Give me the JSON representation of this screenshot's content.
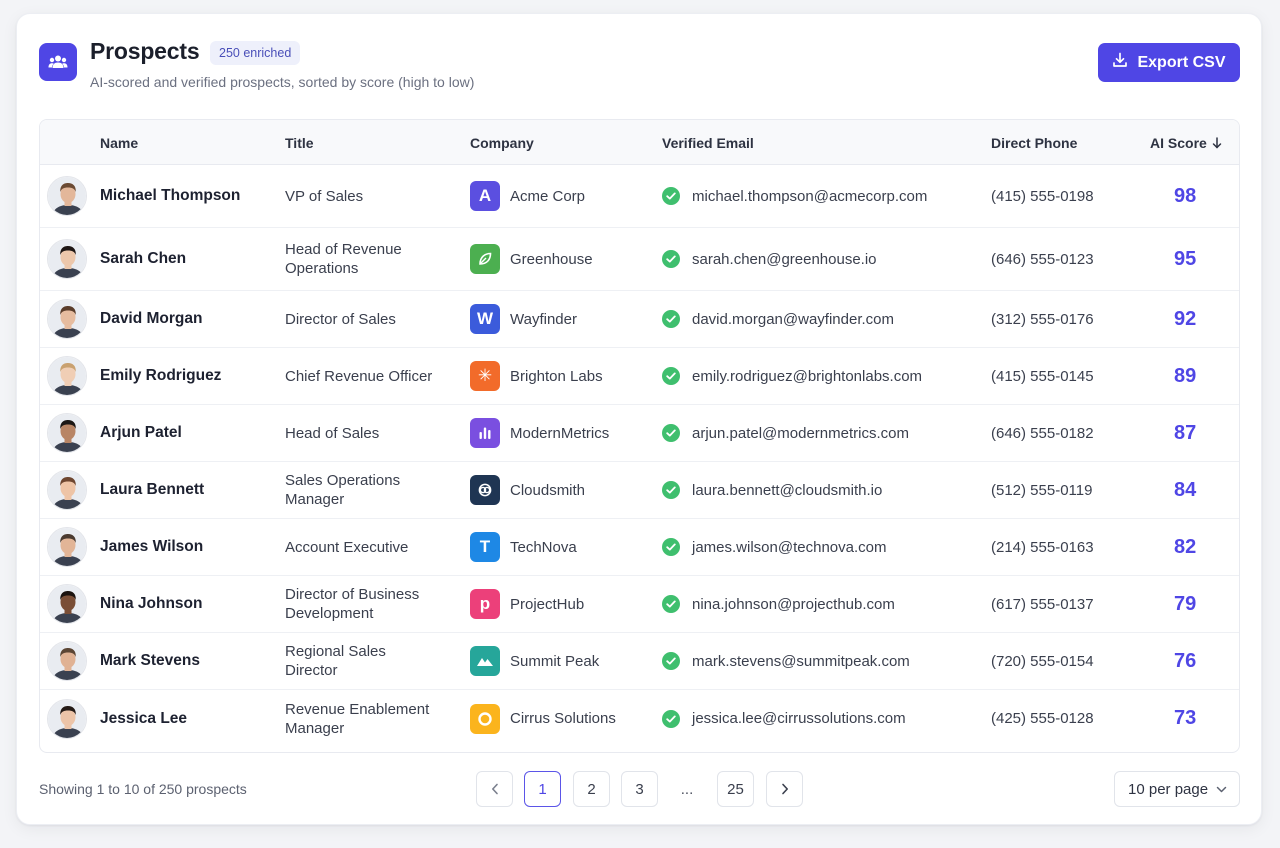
{
  "header": {
    "title": "Prospects",
    "badge": "250 enriched",
    "subtitle": "AI-scored and verified prospects, sorted by score (high to low)",
    "export_label": "Export CSV",
    "accent": "#4f46e5"
  },
  "columns": {
    "name": "Name",
    "title": "Title",
    "company": "Company",
    "email": "Verified Email",
    "phone": "Direct Phone",
    "score": "AI Score"
  },
  "rows": [
    {
      "name": "Michael Thompson",
      "title": "VP of Sales",
      "company": "Acme Corp",
      "logo": "A",
      "logo_color": "#5b4fe0",
      "email": "michael.thompson@acmecorp.com",
      "phone": "(415) 555-0198",
      "score": "98",
      "skin": "#e3b79a",
      "hair": "#6b4a33"
    },
    {
      "name": "Sarah Chen",
      "title": "Head of Revenue Operations",
      "company": "Greenhouse",
      "logo": "leaf",
      "logo_color": "#4caf50",
      "email": "sarah.chen@greenhouse.io",
      "phone": "(646) 555-0123",
      "score": "95",
      "skin": "#ecc7ab",
      "hair": "#1e1614"
    },
    {
      "name": "David Morgan",
      "title": "Director of Sales",
      "company": "Wayfinder",
      "logo": "W",
      "logo_color": "#3b5bdb",
      "email": "david.morgan@wayfinder.com",
      "phone": "(312) 555-0176",
      "score": "92",
      "skin": "#e6bc9f",
      "hair": "#5a3d2b"
    },
    {
      "name": "Emily Rodriguez",
      "title": "Chief Revenue Officer",
      "company": "Brighton Labs",
      "logo": "✳",
      "logo_color": "#f26b2a",
      "email": "emily.rodriguez@brightonlabs.com",
      "phone": "(415) 555-0145",
      "score": "89",
      "skin": "#f0ceb5",
      "hair": "#c9a170"
    },
    {
      "name": "Arjun Patel",
      "title": "Head of Sales",
      "company": "ModernMetrics",
      "logo": "bars",
      "logo_color": "#7a4fe0",
      "email": "arjun.patel@modernmetrics.com",
      "phone": "(646) 555-0182",
      "score": "87",
      "skin": "#b88565",
      "hair": "#1b1715"
    },
    {
      "name": "Laura Bennett",
      "title": "Sales Operations Manager",
      "company": "Cloudsmith",
      "logo": "cloud",
      "logo_color": "#1f3553",
      "email": "laura.bennett@cloudsmith.io",
      "phone": "(512) 555-0119",
      "score": "84",
      "skin": "#eec4a6",
      "hair": "#6e4630"
    },
    {
      "name": "James Wilson",
      "title": "Account Executive",
      "company": "TechNova",
      "logo": "T",
      "logo_color": "#1e88e5",
      "email": "james.wilson@technova.com",
      "phone": "(214) 555-0163",
      "score": "82",
      "skin": "#e2b597",
      "hair": "#4a3a30"
    },
    {
      "name": "Nina Johnson",
      "title": "Director of Business Development",
      "company": "ProjectHub",
      "logo": "p",
      "logo_color": "#ec407a",
      "email": "nina.johnson@projecthub.com",
      "phone": "(617) 555-0137",
      "score": "79",
      "skin": "#7a4e36",
      "hair": "#1a120e"
    },
    {
      "name": "Mark Stevens",
      "title": "Regional Sales Director",
      "company": "Summit Peak",
      "logo": "peak",
      "logo_color": "#26a69a",
      "email": "mark.stevens@summitpeak.com",
      "phone": "(720) 555-0154",
      "score": "76",
      "skin": "#e0b294",
      "hair": "#5b4534"
    },
    {
      "name": "Jessica Lee",
      "title": "Revenue Enablement Manager",
      "company": "Cirrus Solutions",
      "logo": "ring",
      "logo_color": "#fbb41d",
      "email": "jessica.lee@cirrussolutions.com",
      "phone": "(425) 555-0128",
      "score": "73",
      "skin": "#ecc4a8",
      "hair": "#241a16"
    }
  ],
  "footer": {
    "showing": "Showing 1 to 10 of 250 prospects",
    "pages": [
      "1",
      "2",
      "3",
      "25"
    ],
    "ellipsis": "...",
    "current_page": "1",
    "per_page": "10 per page"
  }
}
